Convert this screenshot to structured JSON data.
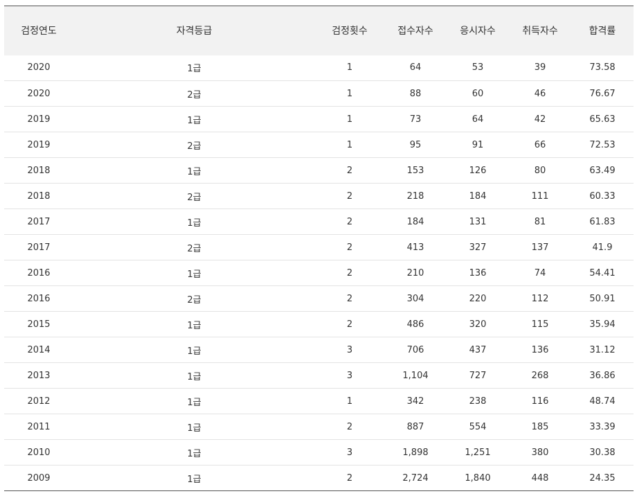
{
  "table": {
    "headers": [
      "검정연도",
      "자격등급",
      "검정횟수",
      "접수자수",
      "응시자수",
      "취득자수",
      "합격률"
    ],
    "rows": [
      [
        "2020",
        "1급",
        "1",
        "64",
        "53",
        "39",
        "73.58"
      ],
      [
        "2020",
        "2급",
        "1",
        "88",
        "60",
        "46",
        "76.67"
      ],
      [
        "2019",
        "1급",
        "1",
        "73",
        "64",
        "42",
        "65.63"
      ],
      [
        "2019",
        "2급",
        "1",
        "95",
        "91",
        "66",
        "72.53"
      ],
      [
        "2018",
        "1급",
        "2",
        "153",
        "126",
        "80",
        "63.49"
      ],
      [
        "2018",
        "2급",
        "2",
        "218",
        "184",
        "111",
        "60.33"
      ],
      [
        "2017",
        "1급",
        "2",
        "184",
        "131",
        "81",
        "61.83"
      ],
      [
        "2017",
        "2급",
        "2",
        "413",
        "327",
        "137",
        "41.9"
      ],
      [
        "2016",
        "1급",
        "2",
        "210",
        "136",
        "74",
        "54.41"
      ],
      [
        "2016",
        "2급",
        "2",
        "304",
        "220",
        "112",
        "50.91"
      ],
      [
        "2015",
        "1급",
        "2",
        "486",
        "320",
        "115",
        "35.94"
      ],
      [
        "2014",
        "1급",
        "3",
        "706",
        "437",
        "136",
        "31.12"
      ],
      [
        "2013",
        "1급",
        "3",
        "1,104",
        "727",
        "268",
        "36.86"
      ],
      [
        "2012",
        "1급",
        "1",
        "342",
        "238",
        "116",
        "48.74"
      ],
      [
        "2011",
        "1급",
        "2",
        "887",
        "554",
        "185",
        "33.39"
      ],
      [
        "2010",
        "1급",
        "3",
        "1,898",
        "1,251",
        "380",
        "30.38"
      ],
      [
        "2009",
        "1급",
        "2",
        "2,724",
        "1,840",
        "448",
        "24.35"
      ]
    ]
  }
}
